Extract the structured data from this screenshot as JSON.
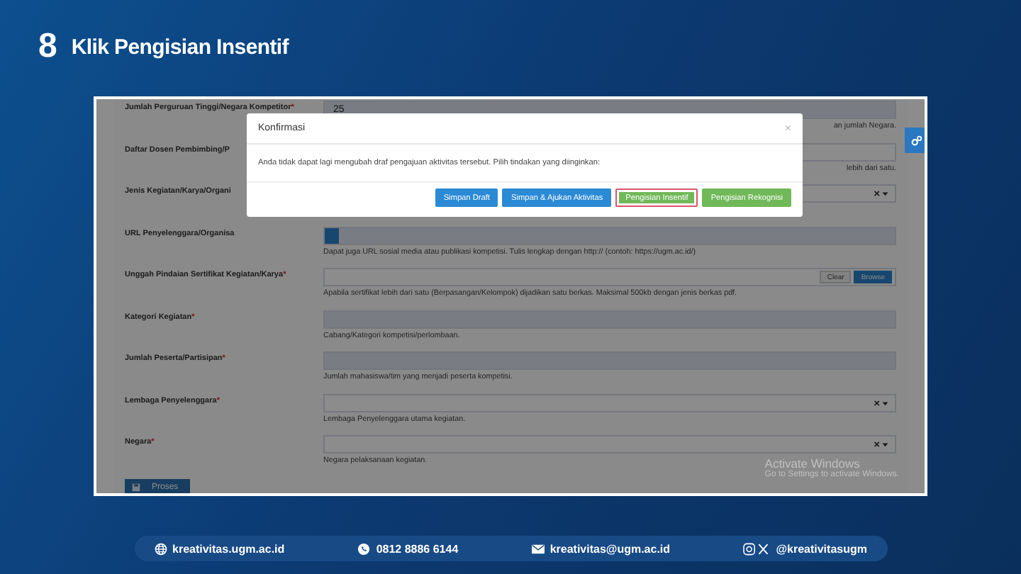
{
  "slide": {
    "step": "8",
    "title": "Klik Pengisian Insentif"
  },
  "form": {
    "fields": [
      {
        "label": "Jumlah Perguruan Tinggi/Negara Kompetitor",
        "mark": "*",
        "kind": "text",
        "value": "25",
        "hint": {
          "text": "an jumlah Negara.",
          "covered": true
        }
      },
      {
        "label": "Daftar Dosen Pembimbing/P",
        "kind": "text",
        "hint": {
          "text": "lebih dari satu.",
          "covered": true
        }
      },
      {
        "label": "Jenis Kegiatan/Karya/Organi",
        "kind": "select"
      },
      {
        "label": "URL Penyelenggara/Organisa",
        "kind": "url",
        "hint": {
          "text": "Dapat juga URL sosial media atau publikasi kompetisi. Tulis lengkap dengan http:// (contoh: https://ugm.ac.id/)",
          "covered": false
        }
      },
      {
        "label": "Unggah Pindaian Sertifikat Kegiatan/Karya",
        "mark": "*",
        "kind": "file",
        "buttons": [
          "Clear",
          "Browse"
        ],
        "hint": {
          "text": "Apabila sertifikat lebih dari satu (Berpasangan/Kelompok) dijadikan satu berkas. Maksimal 500kb dengan jenis berkas pdf.",
          "covered": false
        }
      },
      {
        "label": "Kategori Kegiatan",
        "mark": "*",
        "kind": "text",
        "hint": {
          "text": "Cabang/Kategori kompetisi/perlombaan.",
          "covered": false
        }
      },
      {
        "label": "Jumlah Peserta/Partisipan",
        "mark": "*",
        "kind": "text",
        "hint": {
          "text": "Jumlah mahasiswa/tim yang menjadi peserta kompetisi.",
          "covered": false
        }
      },
      {
        "label": "Lembaga Penyelenggara",
        "mark": "*",
        "kind": "select",
        "hint": {
          "text": "Lembaga Penyelenggara utama kegiatan.",
          "covered": false
        }
      },
      {
        "label": "Negara",
        "mark": "*",
        "kind": "select",
        "hint": {
          "text": "Negara pelaksanaan kegiatan.",
          "covered": false
        }
      }
    ],
    "submit": "Proses"
  },
  "modal": {
    "title": "Konfirmasi",
    "close": "×",
    "message": "Anda tidak dapat lagi mengubah draf pengajuan aktivitas tersebut. Pilih tindakan yang diinginkan:",
    "buttons": [
      {
        "label": "Simpan Draft",
        "kind": "primary",
        "highlighted": false
      },
      {
        "label": "Simpan & Ajukan Aktivitas",
        "kind": "primary",
        "highlighted": false
      },
      {
        "label": "Pengisian Insentif",
        "kind": "success",
        "highlighted": true
      },
      {
        "label": "Pengisian Rekognisi",
        "kind": "success",
        "highlighted": false
      }
    ]
  },
  "watermark": {
    "title": "Activate Windows",
    "subtitle": "Go to Settings to activate Windows."
  },
  "footer": [
    {
      "kind": "web",
      "text": "kreativitas.ugm.ac.id"
    },
    {
      "kind": "whatsapp",
      "text": "0812 8886 6144"
    },
    {
      "kind": "mail",
      "text": "kreativitas@ugm.ac.id"
    },
    {
      "kind": "social",
      "text": "@kreativitasugm"
    }
  ]
}
